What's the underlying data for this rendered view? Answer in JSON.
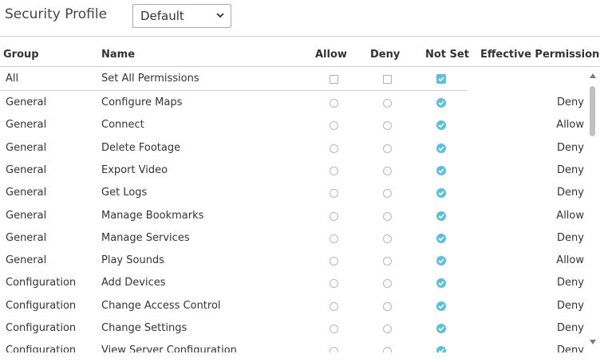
{
  "profile": {
    "label": "Security Profile",
    "selected": "Default"
  },
  "columns": {
    "group": "Group",
    "name": "Name",
    "allow": "Allow",
    "deny": "Deny",
    "notset": "Not Set",
    "effective": "Effective Permission"
  },
  "all_row": {
    "group": "All",
    "name": "Set All Permissions",
    "allow": false,
    "deny": false,
    "notset": true
  },
  "rows": [
    {
      "group": "General",
      "name": "Configure Maps",
      "effective": "Deny"
    },
    {
      "group": "General",
      "name": "Connect",
      "effective": "Allow"
    },
    {
      "group": "General",
      "name": "Delete Footage",
      "effective": "Deny"
    },
    {
      "group": "General",
      "name": "Export Video",
      "effective": "Deny"
    },
    {
      "group": "General",
      "name": "Get Logs",
      "effective": "Deny"
    },
    {
      "group": "General",
      "name": "Manage Bookmarks",
      "effective": "Allow"
    },
    {
      "group": "General",
      "name": "Manage Services",
      "effective": "Deny"
    },
    {
      "group": "General",
      "name": "Play Sounds",
      "effective": "Allow"
    },
    {
      "group": "Configuration",
      "name": "Add Devices",
      "effective": "Deny"
    },
    {
      "group": "Configuration",
      "name": "Change Access Control",
      "effective": "Deny"
    },
    {
      "group": "Configuration",
      "name": "Change Settings",
      "effective": "Deny"
    },
    {
      "group": "Configuration",
      "name": "View Server Configuration",
      "effective": "Deny"
    }
  ],
  "colors": {
    "accent": "#5bc0de"
  }
}
